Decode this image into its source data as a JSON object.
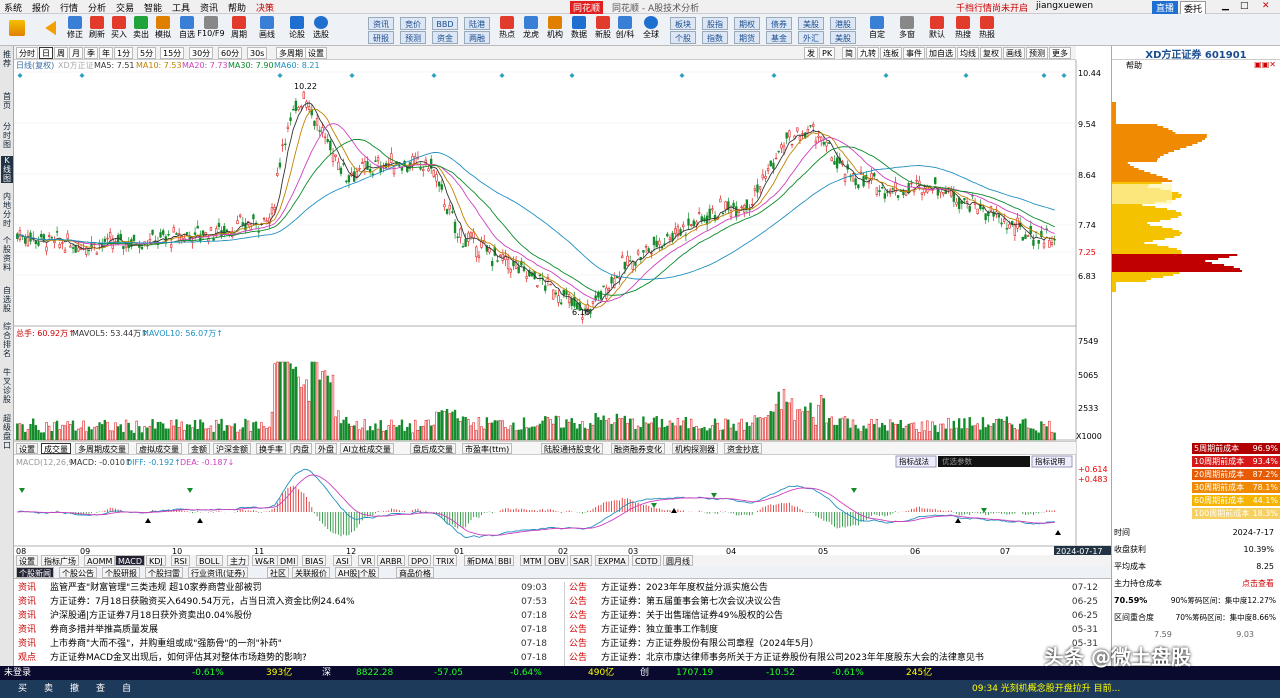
{
  "menu": [
    "系统",
    "报价",
    "行情",
    "分析",
    "交易",
    "智能",
    "工具",
    "资讯",
    "帮助",
    "决策"
  ],
  "app_title": "同花顺 - A股技术分析",
  "header_right": {
    "notice": "千档行情尚未开启",
    "user": "jiangxuewen",
    "btn1": "直播",
    "btn2": "委托"
  },
  "toolbar": [
    "修正",
    "刷新",
    "买入",
    "卖出",
    "模拟",
    "自选",
    "F10/F9",
    "周期",
    "画线",
    "论股",
    "选股"
  ],
  "toolbar_btns": [
    [
      "资讯",
      "研报"
    ],
    [
      "竞价",
      "预测"
    ],
    [
      "BBD",
      "资金"
    ],
    [
      "陆港",
      "两融"
    ]
  ],
  "toolbar2": [
    "热点",
    "龙虎",
    "机构",
    "数据",
    "新股",
    "创/科",
    "全球"
  ],
  "toolbar_btns2": [
    [
      "板块",
      "个股"
    ],
    [
      "股指",
      "指数"
    ],
    [
      "期权",
      "期货"
    ],
    [
      "债券",
      "基金"
    ],
    [
      "美股",
      "外汇"
    ],
    [
      "港股",
      "美股"
    ]
  ],
  "toolbar3": [
    "自定",
    "多窗",
    "默认",
    "热搜",
    "热报"
  ],
  "leftbar": [
    "推荐",
    "首页",
    "分时图",
    "K线图",
    "内地分时",
    "个股资料",
    "自选股",
    "综合排名",
    "牛叉诊股",
    "超级盘口"
  ],
  "periods": [
    "分时",
    "日",
    "周",
    "月",
    "季",
    "年",
    "1分",
    "5分",
    "15分",
    "30分",
    "60分",
    "30s",
    "多周期",
    "设置"
  ],
  "period_selected": "日",
  "chart_tools": [
    "发",
    "PK",
    "简",
    "九转",
    "连板",
    "事件",
    "加自选",
    "均线",
    "复权",
    "画线",
    "预测",
    "更多"
  ],
  "ma_legend": {
    "title": "日线(复权)",
    "stock": "XD方正证",
    "ma5": "MA5: 7.51",
    "ma10": "MA10: 7.53",
    "ma20": "MA20: 7.73",
    "ma30": "MA30: 7.90",
    "ma60": "MA60: 8.21"
  },
  "price_axis": [
    "10.44",
    "9.54",
    "8.64",
    "7.74",
    "7.25",
    "6.83"
  ],
  "annot": {
    "high": "10.22",
    "low": "6.16"
  },
  "vol_legend": {
    "total": "总手: 60.92万↑",
    "mavol5": "MAVOL5: 53.44万↑",
    "mavol10": "MAVOL10: 56.07万↑"
  },
  "vol_axis": [
    "7549",
    "5065",
    "2533",
    "X1000"
  ],
  "subtabs": [
    "设置",
    "成交量",
    "多周期成交量",
    "虚拟成交量",
    "金额",
    "沪深金额",
    "换手率",
    "内盘",
    "外盘",
    "AI立桩成交量",
    "盘后成交量",
    "市盈率(ttm)",
    "陆股通持股变化",
    "融资融券变化",
    "机构探测器",
    "资金抄底"
  ],
  "macd_legend": {
    "name": "MACD(12,26,9)",
    "macd": "MACD: -0.010↑",
    "diff": "DIFF: -0.192↑",
    "dea": "DEA: -0.187↓"
  },
  "macd_axis": [
    "+0.614",
    "+0.483"
  ],
  "macd_buttons": [
    "指标战法",
    "优选参数",
    "指标说明"
  ],
  "months": [
    "08",
    "09",
    "10",
    "11",
    "12",
    "01",
    "02",
    "03",
    "04",
    "05",
    "06",
    "07"
  ],
  "date_label": "2024-07-17",
  "ind_tabs": [
    "设置",
    "指标广场",
    "AOMM",
    "MACD",
    "KDJ",
    "RSI",
    "BOLL",
    "主力",
    "W&R",
    "DMI",
    "BIAS",
    "ASI",
    "VR",
    "ARBR",
    "DPO",
    "TRIX",
    "新DMA",
    "BBI",
    "MTM",
    "OBV",
    "SAR",
    "EXPMA",
    "CDTD",
    "圆月线"
  ],
  "news_tabs": [
    "个股新闻",
    "个股公告",
    "个股研报",
    "个股扫雷",
    "行业资讯(证券)",
    "社区",
    "关联报价",
    "AH股|个股",
    "商品价格"
  ],
  "news_left": [
    {
      "tag": "资讯",
      "text": "监管严查\"财富管理\"三类违规 超10家券商营业部被罚",
      "time": "09:03"
    },
    {
      "tag": "资讯",
      "text": "方正证券：7月18日获融资买入6490.54万元，占当日流入资金比例24.64%",
      "time": "07:53"
    },
    {
      "tag": "资讯",
      "text": "沪深股通|方正证券7月18日获外资卖出0.04%股份",
      "time": "07:18"
    },
    {
      "tag": "资讯",
      "text": "券商多措并举推高质量发展",
      "time": "07-18"
    },
    {
      "tag": "资讯",
      "text": "上市券商\"大而不强\"，并购重组或成\"强筋骨\"的一剂\"补药\"",
      "time": "07-18"
    },
    {
      "tag": "观点",
      "text": "方正证券MACD金叉出现后，如何评估其对整体市场趋势的影响?",
      "time": "07-18"
    }
  ],
  "news_right": [
    {
      "tag": "公告",
      "text": "方正证券：2023年年度权益分派实施公告",
      "time": "07-12"
    },
    {
      "tag": "公告",
      "text": "方正证券：第五届董事会第七次会议决议公告",
      "time": "06-25"
    },
    {
      "tag": "公告",
      "text": "方正证券：关于出售瑞信证券49%股权的公告",
      "time": "06-25"
    },
    {
      "tag": "公告",
      "text": "方正证券：独立董事工作制度",
      "time": "05-31"
    },
    {
      "tag": "公告",
      "text": "方正证券：方正证券股份有限公司章程（2024年5月）",
      "time": "05-31"
    },
    {
      "tag": "公告",
      "text": "方正证券：北京市康达律师事务所关于方正证券股份有限公司2023年年度股东大会的法律意见书",
      "time": ""
    }
  ],
  "right_panel": {
    "title": "XD方正证券 601901",
    "help": "帮助",
    "chips": [
      {
        "label": "5周期前成本",
        "val": "96.9%"
      },
      {
        "label": "10周期前成本",
        "val": "93.4%"
      },
      {
        "label": "20周期前成本",
        "val": "87.2%"
      },
      {
        "label": "30周期前成本",
        "val": "78.1%"
      },
      {
        "label": "60周期前成本",
        "val": "44.1%"
      },
      {
        "label": "100周期前成本",
        "val": "18.3%"
      }
    ],
    "time_label": "时间",
    "time_val": "2024-7-17",
    "profit_label": "收盘获利",
    "profit_val": "10.39%",
    "avg_label": "平均成本",
    "avg_val": "8.25",
    "main_label": "主力持仓成本",
    "main_val": "点击查看",
    "c90": "70.59%",
    "c90_label": "90%筹码区间：集中度12.27%",
    "c70_label": "区间重合度",
    "c70": "70%筹码区间：集中度8.66%",
    "bottom1": "7.59",
    "bottom2": "9.03"
  },
  "status": {
    "left": "未登录",
    "quotes": [
      "-0.61%",
      "393亿",
      "深",
      "8822.28",
      "-57.05",
      "-0.64%",
      "490亿",
      "创",
      "1707.19",
      "-10.52",
      "-0.61%",
      "245亿"
    ],
    "right": "09:34 光刻机概念股开盘拉升 目前...",
    "watermark": "头条 @微土盘股"
  },
  "taskbar": [
    "买",
    "卖",
    "撤",
    "查",
    "自"
  ]
}
